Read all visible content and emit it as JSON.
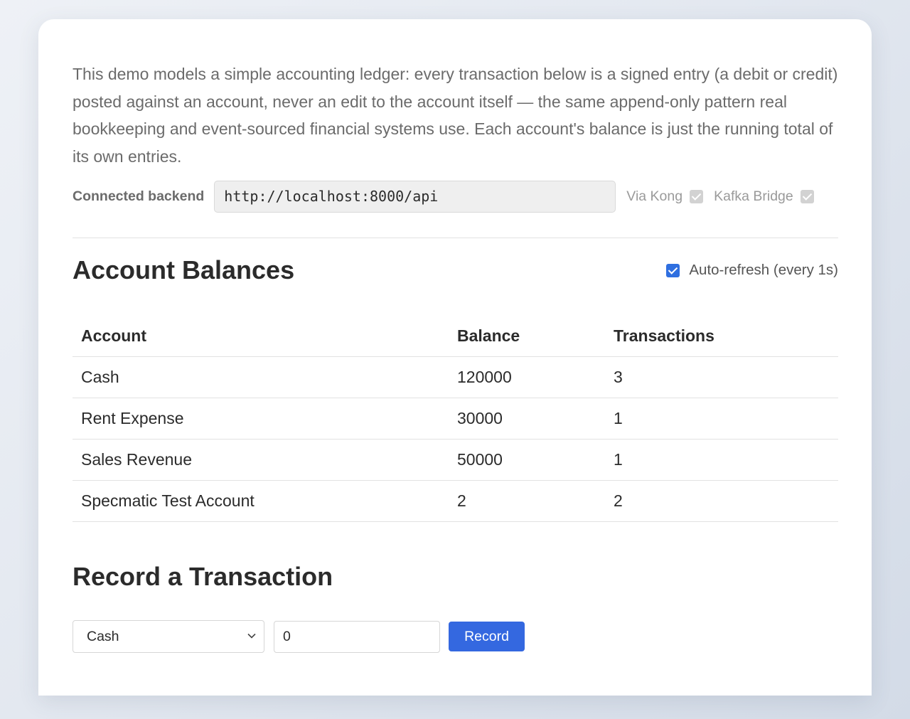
{
  "intro": {
    "text": "This demo models a simple accounting ledger: every transaction below is a signed entry (a debit or credit) posted against an account, never an edit to the account itself — the same append-only pattern real bookkeeping and event-sourced financial systems use. Each account's balance is just the running total of its own entries."
  },
  "backend": {
    "label": "Connected backend",
    "url": "http://localhost:8000/api",
    "flags": [
      {
        "label": "Via Kong",
        "checked": true,
        "disabled": true
      },
      {
        "label": "Kafka Bridge",
        "checked": true,
        "disabled": true
      }
    ]
  },
  "balances": {
    "title": "Account Balances",
    "auto_refresh_label": "Auto-refresh (every 1s)",
    "auto_refresh_checked": true,
    "columns": [
      "Account",
      "Balance",
      "Transactions"
    ],
    "rows": [
      {
        "account": "Cash",
        "balance": "120000",
        "transactions": "3"
      },
      {
        "account": "Rent Expense",
        "balance": "30000",
        "transactions": "1"
      },
      {
        "account": "Sales Revenue",
        "balance": "50000",
        "transactions": "1"
      },
      {
        "account": "Specmatic Test Account",
        "balance": "2",
        "transactions": "2"
      }
    ]
  },
  "record": {
    "title": "Record a Transaction",
    "selected_account": "Cash",
    "amount": "0",
    "button_label": "Record"
  },
  "colors": {
    "accent": "#3468e0",
    "card": "#ffffff",
    "muted_text": "#6b6b6b"
  }
}
